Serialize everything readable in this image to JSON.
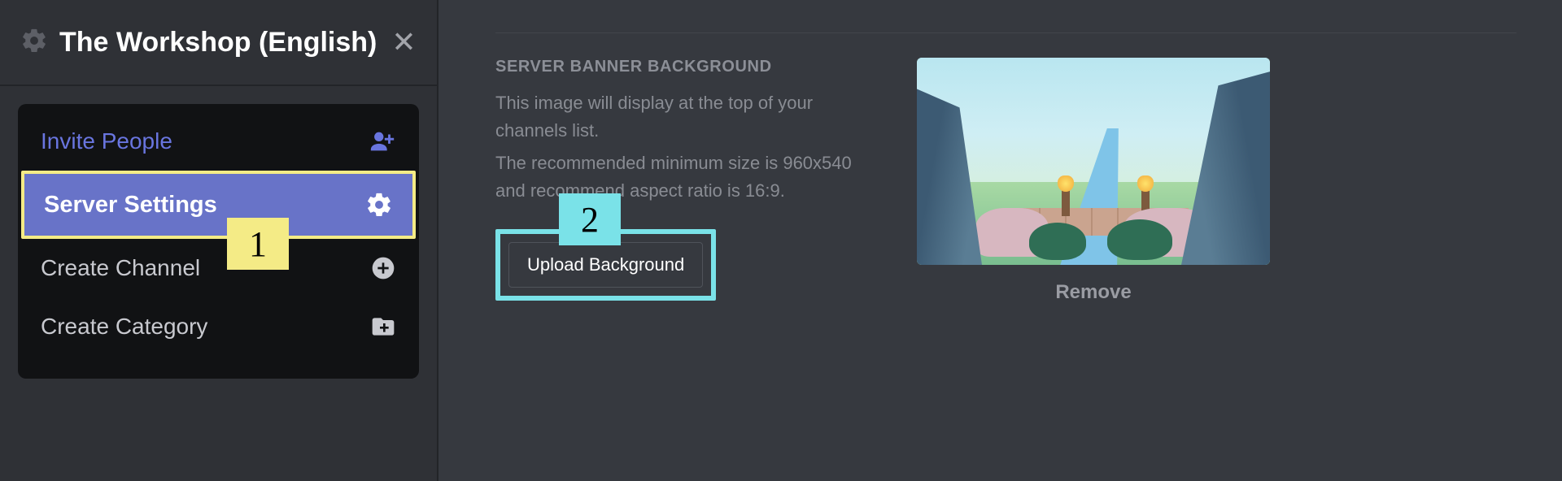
{
  "server": {
    "title": "The Workshop (English)"
  },
  "menu": {
    "invite": "Invite People",
    "settings": "Server Settings",
    "createChannel": "Create Channel",
    "createCategory": "Create Category"
  },
  "annotations": {
    "step1": "1",
    "step2": "2"
  },
  "banner": {
    "heading": "SERVER BANNER BACKGROUND",
    "desc1": "This image will display at the top of your channels list.",
    "desc2": "The recommended minimum size is 960x540 and recommend aspect ratio is 16:9.",
    "uploadLabel": "Upload Background",
    "removeLabel": "Remove"
  }
}
